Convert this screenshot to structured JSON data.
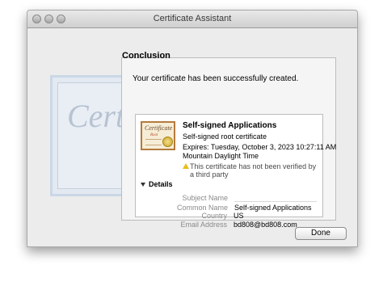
{
  "window": {
    "title": "Certificate Assistant"
  },
  "heading": "Conclusion",
  "message": "Your certificate has been successfully created.",
  "background_certificate_text": "Certif",
  "certificate": {
    "icon_text": "Certificate",
    "icon_subtext": "Root",
    "name": "Self-signed Applications",
    "type": "Self-signed root certificate",
    "expires_line1": "Expires: Tuesday, October 3, 2023 10:27:11 AM",
    "expires_line2": "Mountain Daylight Time",
    "warning": "This certificate has not been verified by a third party"
  },
  "details": {
    "label": "Details",
    "fields": [
      {
        "label": "Subject Name",
        "value": ""
      },
      {
        "label": "Common Name",
        "value": "Self-signed Applications"
      },
      {
        "label": "Country",
        "value": "US"
      },
      {
        "label": "Email Address",
        "value": "bd808@bd808.com"
      }
    ]
  },
  "buttons": {
    "done": "Done"
  },
  "icons": {
    "close": "close-icon",
    "minimize": "minimize-icon",
    "zoom": "zoom-icon",
    "warning": "warning-icon",
    "disclosure": "disclosure-triangle-icon",
    "certificate": "certificate-icon"
  }
}
